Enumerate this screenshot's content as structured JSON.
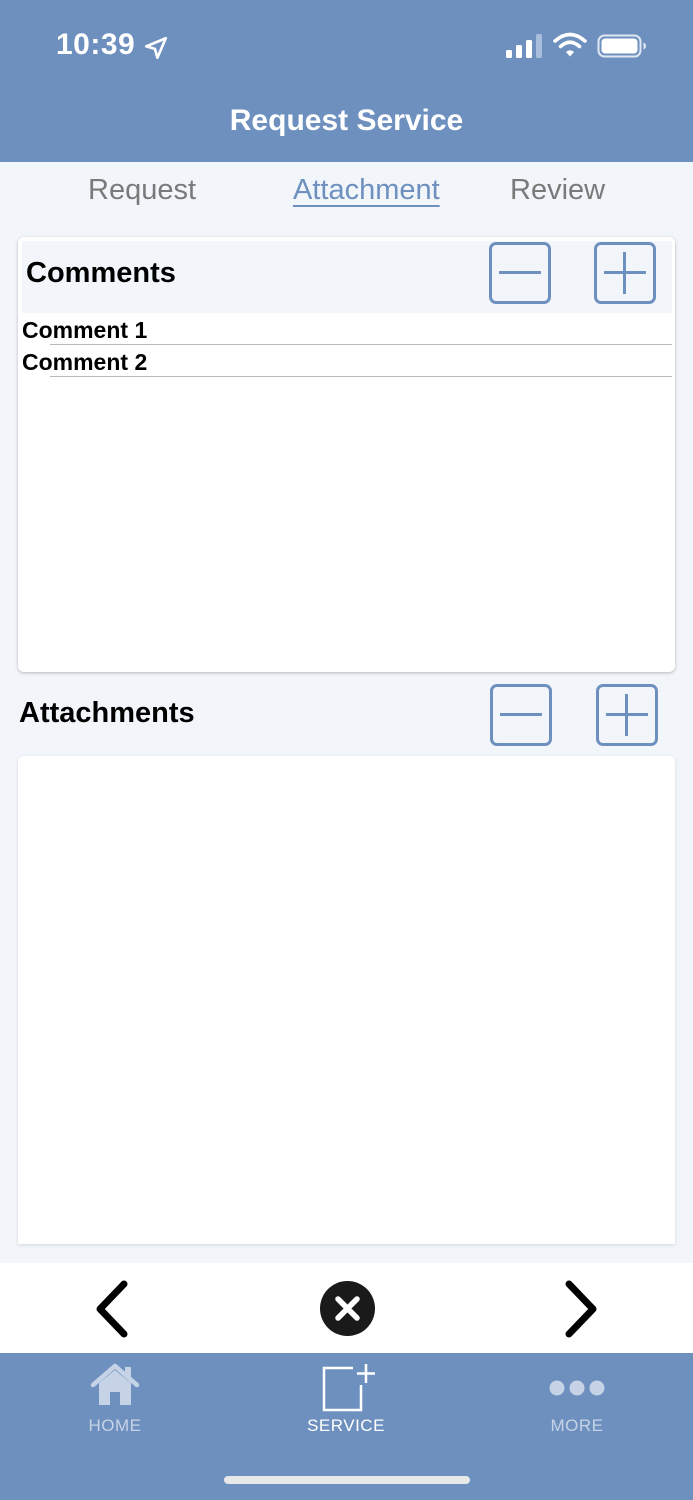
{
  "status_bar": {
    "time": "10:39"
  },
  "header": {
    "title": "Request Service"
  },
  "tabs": [
    {
      "label": "Request",
      "active": false
    },
    {
      "label": "Attachment",
      "active": true
    },
    {
      "label": "Review",
      "active": false
    }
  ],
  "comments": {
    "title": "Comments",
    "items": [
      "Comment 1",
      "Comment 2"
    ]
  },
  "attachments": {
    "title": "Attachments",
    "items": []
  },
  "tabbar": {
    "home": "HOME",
    "service": "SERVICE",
    "more": "MORE"
  },
  "colors": {
    "accent": "#6e90bf",
    "background": "#f2f5fa",
    "inactive_tab_text": "#7a7a7a"
  },
  "icons": [
    "location-arrow-icon",
    "cellular-signal-icon",
    "wifi-icon",
    "battery-icon",
    "minus-icon",
    "plus-icon",
    "chevron-left-icon",
    "close-circle-icon",
    "chevron-right-icon",
    "home-icon",
    "service-add-icon",
    "more-dots-icon"
  ]
}
